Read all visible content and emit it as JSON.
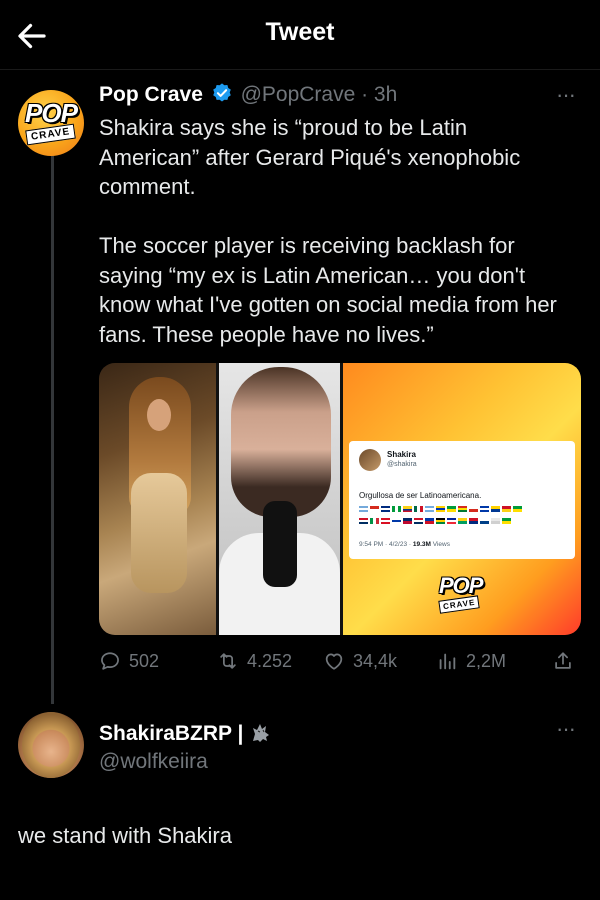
{
  "header": {
    "title": "Tweet",
    "back_icon": "arrow-left-icon"
  },
  "colors": {
    "background": "#000000",
    "text": "#e7e9ea",
    "secondary": "#71767b",
    "verified_blue": "#1d9bf0"
  },
  "main_tweet": {
    "avatar_pop": "POP",
    "avatar_crave": "CRAVE",
    "name": "Pop Crave",
    "handle_time": "@PopCrave · 3h",
    "paragraph_1": "Shakira says she is “proud to be Latin American” after Gerard Piqué's xenophobic comment.",
    "paragraph_2": "The soccer player is receiving backlash for saying “my ex is Latin American… you don't know what I've gotten on social media from her fans. These people have no lives.”",
    "embedded_card": {
      "name": "Shakira",
      "handle": "@shakira",
      "text": "Orgullosa de ser Latinoamericana.",
      "time": "9:54 PM · 4/2/23 · ",
      "views": "19.3M",
      "views_label": "Views"
    },
    "watermark_pop": "POP",
    "watermark_crave": "CRAVE",
    "actions": {
      "replies": "502",
      "retweets": "4.252",
      "likes": "34,4k",
      "views": "2,2M"
    }
  },
  "reply": {
    "name": "ShakiraBZRP |",
    "handle": "@wolfkeiira",
    "text": "we stand with Shakira"
  }
}
